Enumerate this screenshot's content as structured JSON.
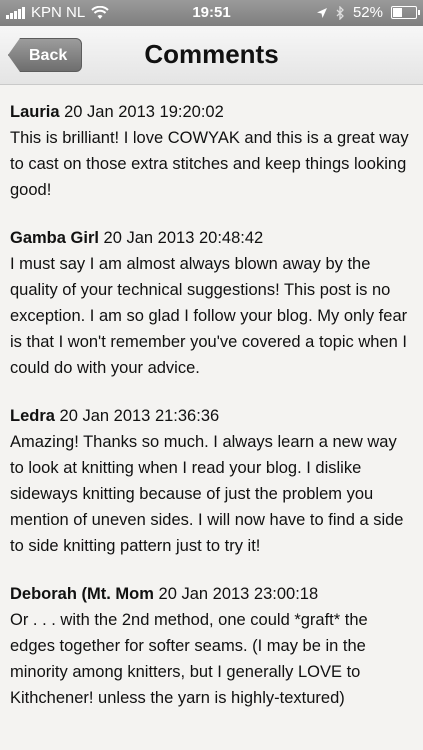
{
  "status_bar": {
    "carrier": "KPN NL",
    "time": "19:51",
    "battery": "52%",
    "battery_level": 0.52
  },
  "nav": {
    "back_label": "Back",
    "title": "Comments"
  },
  "comments": [
    {
      "author": "Lauria",
      "date": "20 Jan 2013 19:20:02",
      "text": "This is brilliant! I love COWYAK and this is a great way to cast on those extra stitches and keep things looking good!"
    },
    {
      "author": "Gamba Girl",
      "date": "20 Jan 2013 20:48:42",
      "text": "I must say I am almost always blown away by the quality of your technical suggestions! This post is no exception. I am so glad I follow your blog. My only fear is that I won't remember you've covered a topic when I could do with your advice."
    },
    {
      "author": "Ledra",
      "date": "20 Jan 2013 21:36:36",
      "text": "Amazing! Thanks so much. I always learn a new way to look at knitting when I read your blog. I dislike sideways knitting because of just the problem you mention of uneven sides. I will now have to find a side to side knitting pattern just to try it!"
    },
    {
      "author": "Deborah (Mt. Mom",
      "date": "20 Jan 2013 23:00:18",
      "text": "Or . . . with the 2nd method, one could *graft* the edges together for softer seams. (I may be in the minority among knitters, but I generally LOVE to Kithchener! unless the yarn is highly-textured)"
    }
  ]
}
